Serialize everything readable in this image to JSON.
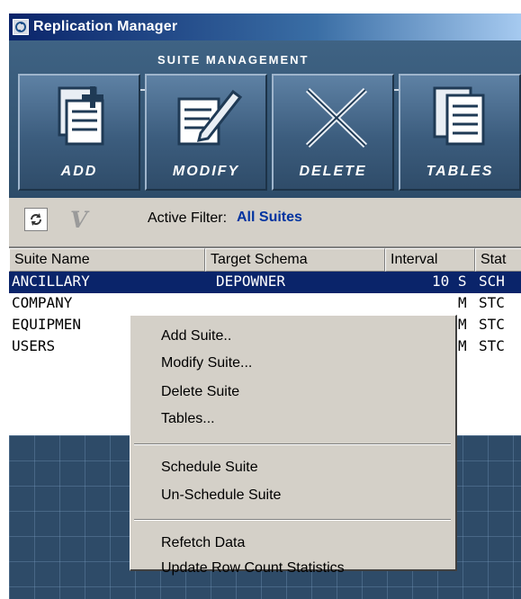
{
  "window": {
    "title": "Replication Manager"
  },
  "suite_management": {
    "section_title": "SUITE MANAGEMENT",
    "buttons": [
      {
        "label": "ADD",
        "icon": "add-document-icon"
      },
      {
        "label": "MODIFY",
        "icon": "edit-document-icon"
      },
      {
        "label": "DELETE",
        "icon": "delete-x-icon"
      },
      {
        "label": "TABLES",
        "icon": "tables-icon"
      }
    ]
  },
  "filterbar": {
    "refresh_icon": "refresh-icon",
    "filter_icon": "filter-v-icon",
    "filter_glyph": "V",
    "label": "Active Filter:",
    "value": "All Suites"
  },
  "table": {
    "columns": [
      "Suite Name",
      "Target Schema",
      "Interval",
      "Stat"
    ],
    "rows": [
      {
        "name": "ANCILLARY",
        "schema": "DEPOWNER",
        "interval": "10 S",
        "status": "SCH",
        "selected": true
      },
      {
        "name": "COMPANY",
        "schema": "",
        "interval": "M",
        "status": "STC",
        "selected": false
      },
      {
        "name": "EQUIPMEN",
        "schema": "",
        "interval": "M",
        "status": "STC",
        "selected": false
      },
      {
        "name": "USERS",
        "schema": "",
        "interval": "M",
        "status": "STC",
        "selected": false
      }
    ]
  },
  "context_menu": {
    "items": [
      "Add Suite..",
      "Modify Suite...",
      "Delete Suite",
      "Tables...",
      "Schedule Suite",
      "Un-Schedule Suite",
      "Refetch Data",
      "Update Row Count Statistics"
    ]
  },
  "colors": {
    "title_start": "#0a246a",
    "panel": "#2e4a66",
    "selection": "#0a246a",
    "filter_value": "#0033a0",
    "dialog_face": "#d4d0c8"
  }
}
